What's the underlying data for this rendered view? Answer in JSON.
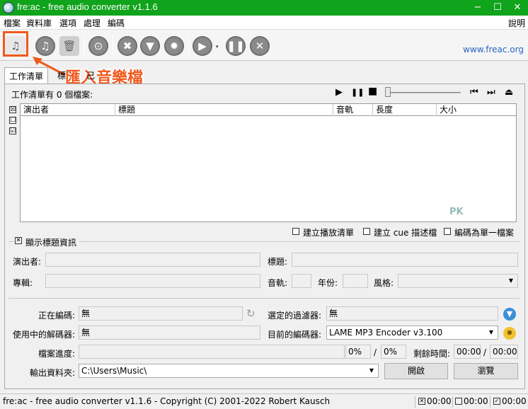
{
  "window": {
    "title": "fre:ac - free audio converter v1.1.6",
    "minimize": "−",
    "maximize": "☐",
    "close": "✕"
  },
  "menu": {
    "items": [
      "檔案",
      "資料庫",
      "選項",
      "處理",
      "編碼"
    ],
    "help": "說明"
  },
  "toolbar": {
    "site_link": "www.freac.org",
    "dropdown_arrow": "▾"
  },
  "annotation": {
    "text": "匯入音樂檔",
    "color": "#f05a1e"
  },
  "tabs": {
    "worklist": "工作清單",
    "second": "標",
    "third": "己"
  },
  "joblist": {
    "count_text": "工作清單有 0 個檔案:",
    "columns": [
      "演出者",
      "標題",
      "音軌",
      "長度",
      "大小"
    ],
    "side_checks": [
      "☒",
      "☐",
      "☑"
    ]
  },
  "player": {
    "play": "▶",
    "pause": "❚❚",
    "stop": "■",
    "prev": "⏮",
    "next": "⏭",
    "eject": "⏏"
  },
  "watermark": "PK",
  "options": {
    "create_playlist": "建立播放清單",
    "create_cue": "建立 cue 描述檔",
    "encode_single": "編碼為單一檔案"
  },
  "title_info": {
    "toggle_label": "顯示標題資訊",
    "artist_label": "演出者:",
    "title_label": "標題:",
    "album_label": "專輯:",
    "track_label": "音軌:",
    "year_label": "年份:",
    "genre_label": "風格:"
  },
  "status": {
    "encoding_label": "正在編碼:",
    "encoding_value": "無",
    "decoder_label": "使用中的解碼器:",
    "decoder_value": "無",
    "filter_label": "選定的過濾器:",
    "filter_value": "無",
    "encoder_label": "目前的編碼器:",
    "encoder_value": "LAME MP3 Encoder v3.100",
    "progress_label": "檔案進度:",
    "file_progress": "0%",
    "slash": "/",
    "total_progress": "0%",
    "remaining_label": "剩餘時間:",
    "time_elapsed": "00:00",
    "time_total": "00:00",
    "output_label": "輸出資料夾:",
    "output_value": "C:\\Users\\Music\\",
    "open_button": "開啟",
    "browse_button": "瀏覽"
  },
  "statusbar": {
    "copyright": "fre:ac - free audio converter v1.1.6 - Copyright (C) 2001-2022 Robert Kausch",
    "t1": "00:00",
    "t2": "00:00",
    "t3": "00:00"
  }
}
